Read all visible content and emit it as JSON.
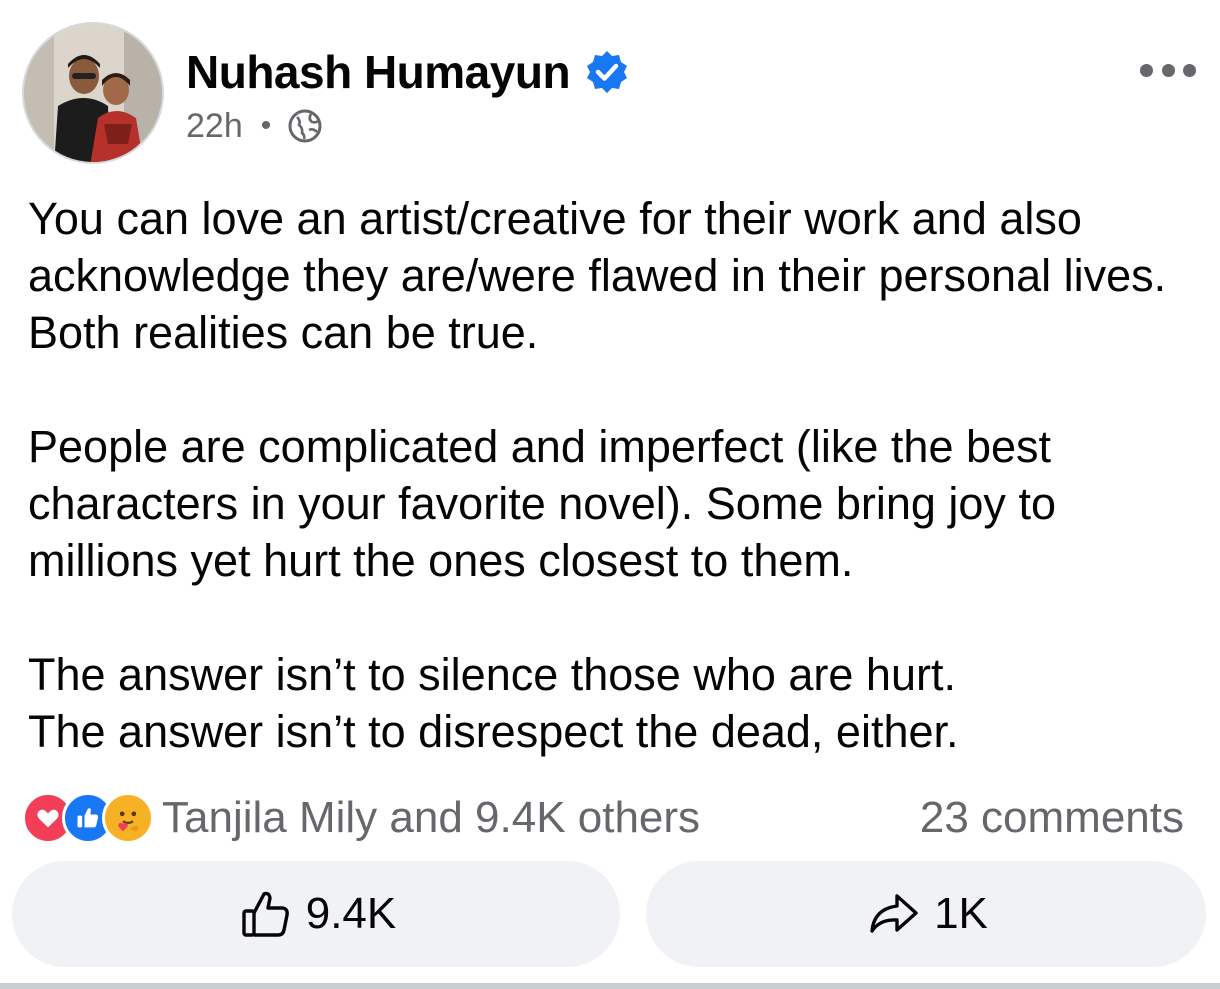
{
  "post": {
    "author": {
      "name": "Nuhash Humayun",
      "verified_icon": "verified-badge-icon",
      "avatar": "profile-photo"
    },
    "time": "22h",
    "separator": "•",
    "audience_icon": "globe-icon",
    "more_icon": "more-options-icon",
    "paragraphs": [
      "You can love an artist/creative for their work and also acknowledge they are/were flawed in their personal lives. Both realities can be true.",
      "People are complicated and imperfect (like the best characters in your favorite novel). Some bring joy to millions yet hurt the ones closest to them.",
      "The answer isn’t to silence those who are hurt.\nThe answer isn’t to disrespect the dead, either."
    ],
    "reactions": {
      "icons": [
        "love-reaction-icon",
        "like-reaction-icon",
        "care-reaction-icon"
      ],
      "summary": "Tanjila Mily and 9.4K others"
    },
    "comments": "23 comments",
    "actions": {
      "like_count": "9.4K",
      "share_count": "1K"
    }
  },
  "colors": {
    "accent": "#1877f2",
    "secondary_text": "#65676b",
    "button_bg": "#f0f2f5",
    "love": "#f33e58",
    "care": "#f7b125"
  }
}
